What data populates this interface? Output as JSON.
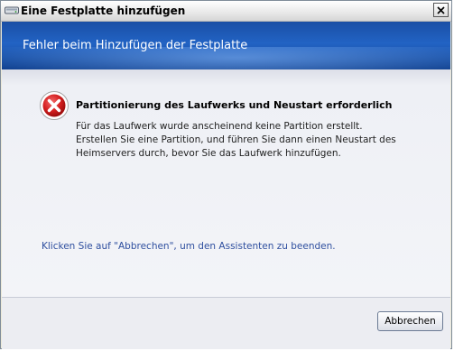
{
  "window": {
    "title": "Eine Festplatte hinzufügen",
    "close_icon": "close-icon"
  },
  "banner": {
    "title": "Fehler beim Hinzufügen der Festplatte",
    "accent": "#2263c4"
  },
  "error": {
    "icon": "error-icon",
    "heading": "Partitionierung des Laufwerks und Neustart erforderlich",
    "body_lines": [
      "Für das Laufwerk wurde anscheinend keine Partition erstellt.",
      "Erstellen Sie eine Partition, und führen Sie dann einen Neustart des",
      "Heimservers durch, bevor Sie das Laufwerk hinzufügen."
    ]
  },
  "hint": {
    "text": "Klicken Sie auf \"Abbrechen\", um den Assistenten zu beenden."
  },
  "buttons": {
    "cancel_label": "Abbrechen"
  }
}
